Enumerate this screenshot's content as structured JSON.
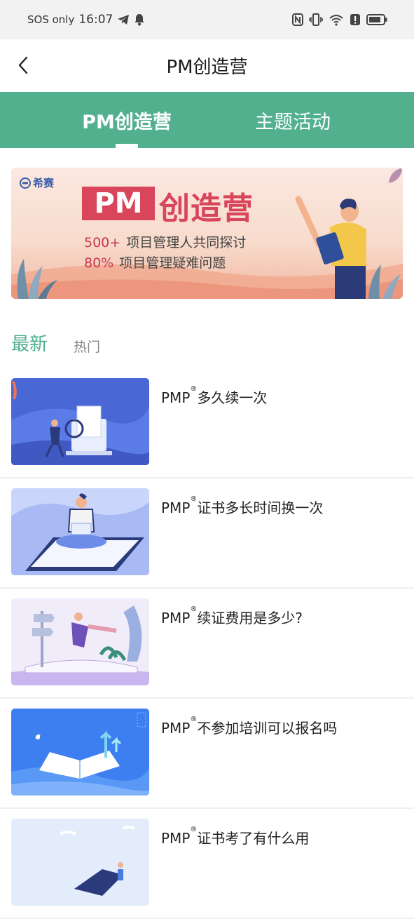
{
  "status_bar": {
    "carrier": "SOS only",
    "time": "16:07"
  },
  "header": {
    "title": "PM创造营"
  },
  "tabs": [
    {
      "label": "PM创造营",
      "active": true
    },
    {
      "label": "主题活动",
      "active": false
    }
  ],
  "banner": {
    "brand": "希赛",
    "pm": "PM",
    "title": "创造营",
    "line1_num": "500+",
    "line1_text": "项目管理人共同探讨",
    "line2_num": "80%",
    "line2_text": "项目管理疑难问题"
  },
  "sort": {
    "newest": "最新",
    "hot": "热门"
  },
  "articles": [
    {
      "prefix": "PMP",
      "mark": "®",
      "title": "多久续一次"
    },
    {
      "prefix": "PMP",
      "mark": "®",
      "title": "证书多长时间换一次"
    },
    {
      "prefix": "PMP",
      "mark": "®",
      "title": "续证费用是多少?"
    },
    {
      "prefix": "PMP",
      "mark": "®",
      "title": "不参加培训可以报名吗"
    },
    {
      "prefix": "PMP",
      "mark": "®",
      "title": "证书考了有什么用"
    }
  ],
  "colors": {
    "accent": "#52b08f",
    "banner_red": "#d9455a"
  }
}
